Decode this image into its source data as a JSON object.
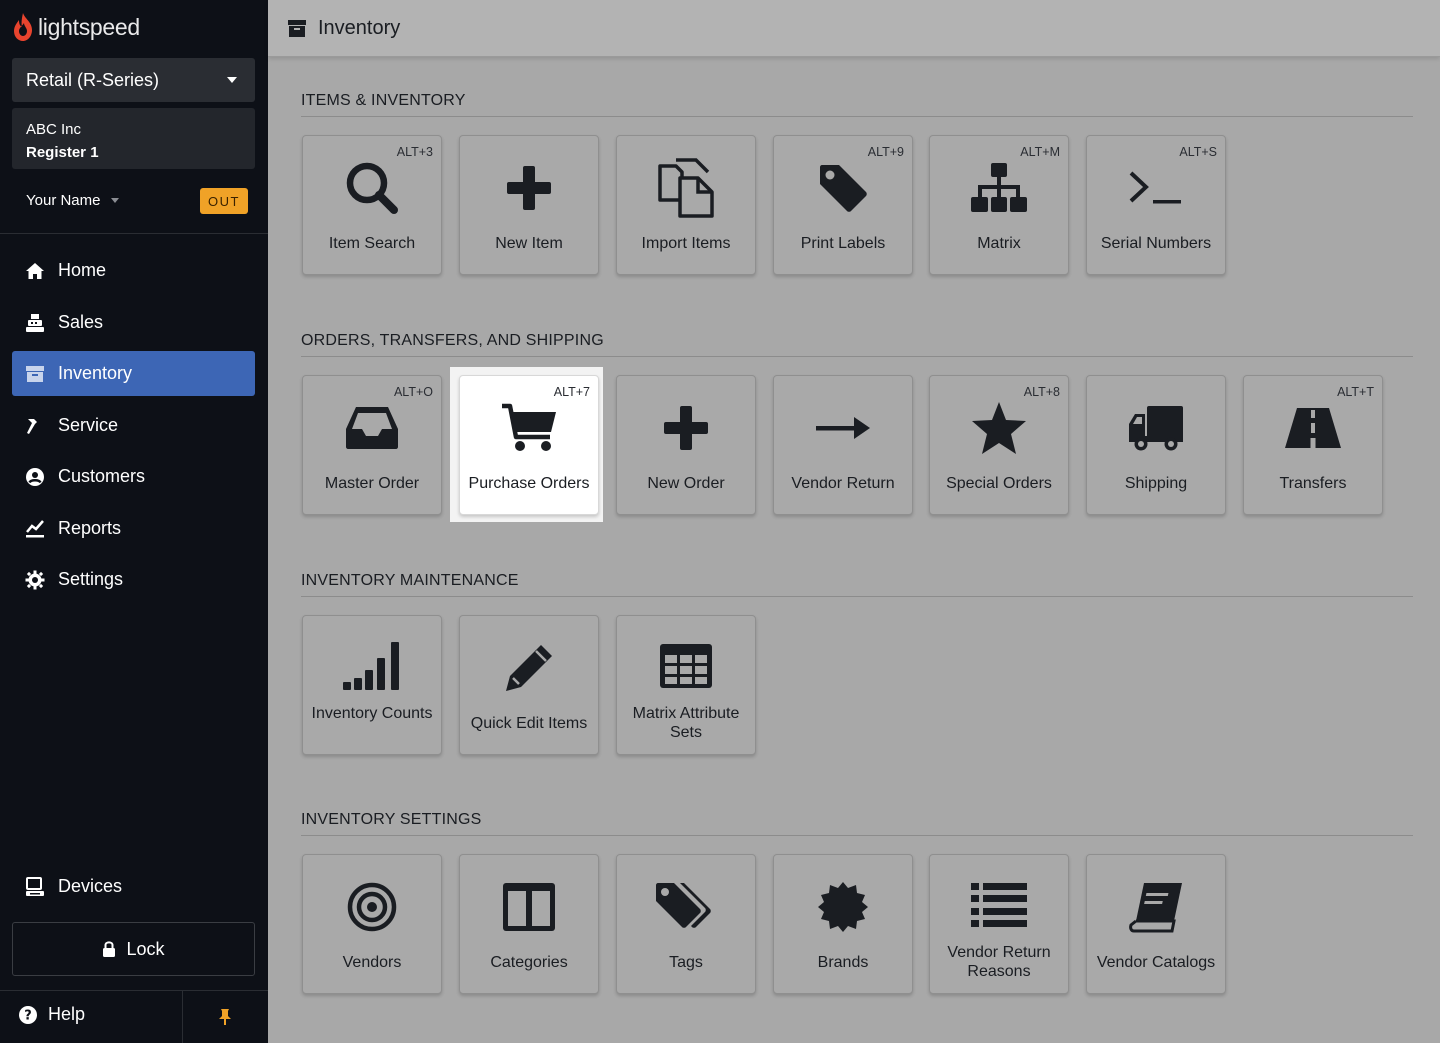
{
  "brand": {
    "name": "lightspeed",
    "accent": "#e8442e"
  },
  "sidebar": {
    "product": "Retail (R-Series)",
    "store": {
      "company": "ABC Inc",
      "register": "Register 1"
    },
    "user": {
      "name": "Your Name",
      "status_badge": "OUT"
    },
    "nav": [
      {
        "label": "Home",
        "icon": "home-icon"
      },
      {
        "label": "Sales",
        "icon": "register-icon"
      },
      {
        "label": "Inventory",
        "icon": "inventory-icon",
        "active": true
      },
      {
        "label": "Service",
        "icon": "wrench-icon"
      },
      {
        "label": "Customers",
        "icon": "user-circle-icon"
      },
      {
        "label": "Reports",
        "icon": "chart-icon"
      },
      {
        "label": "Settings",
        "icon": "gear-icon"
      }
    ],
    "devices": "Devices",
    "lock": "Lock",
    "help": "Help",
    "active_color": "#3d66b5"
  },
  "header": {
    "title": "Inventory"
  },
  "sections": [
    {
      "title": "ITEMS & INVENTORY",
      "tiles": [
        {
          "label": "Item Search",
          "shortcut": "ALT+3",
          "icon": "search-icon"
        },
        {
          "label": "New Item",
          "shortcut": "",
          "icon": "plus-icon"
        },
        {
          "label": "Import Items",
          "shortcut": "",
          "icon": "copy-icon"
        },
        {
          "label": "Print Labels",
          "shortcut": "ALT+9",
          "icon": "tag-icon"
        },
        {
          "label": "Matrix",
          "shortcut": "ALT+M",
          "icon": "sitemap-icon"
        },
        {
          "label": "Serial Numbers",
          "shortcut": "ALT+S",
          "icon": "terminal-icon"
        }
      ]
    },
    {
      "title": "ORDERS, TRANSFERS, AND SHIPPING",
      "tiles": [
        {
          "label": "Master Order",
          "shortcut": "ALT+O",
          "icon": "inbox-icon"
        },
        {
          "label": "Purchase Orders",
          "shortcut": "ALT+7",
          "icon": "cart-icon",
          "highlighted": true
        },
        {
          "label": "New Order",
          "shortcut": "",
          "icon": "plus-icon"
        },
        {
          "label": "Vendor Return",
          "shortcut": "",
          "icon": "arrow-right-icon"
        },
        {
          "label": "Special Orders",
          "shortcut": "ALT+8",
          "icon": "star-icon"
        },
        {
          "label": "Shipping",
          "shortcut": "",
          "icon": "truck-icon"
        },
        {
          "label": "Transfers",
          "shortcut": "ALT+T",
          "icon": "road-icon"
        }
      ]
    },
    {
      "title": "INVENTORY MAINTENANCE",
      "tiles": [
        {
          "label": "Inventory Counts",
          "shortcut": "",
          "icon": "signal-bars-icon"
        },
        {
          "label": "Quick Edit Items",
          "shortcut": "",
          "icon": "pencil-icon"
        },
        {
          "label": "Matrix Attribute Sets",
          "shortcut": "",
          "icon": "table-icon"
        }
      ]
    },
    {
      "title": "INVENTORY SETTINGS",
      "tiles": [
        {
          "label": "Vendors",
          "shortcut": "",
          "icon": "bullseye-icon"
        },
        {
          "label": "Categories",
          "shortcut": "",
          "icon": "columns-icon"
        },
        {
          "label": "Tags",
          "shortcut": "",
          "icon": "tags-icon"
        },
        {
          "label": "Brands",
          "shortcut": "",
          "icon": "certificate-icon"
        },
        {
          "label": "Vendor Return Reasons",
          "shortcut": "",
          "icon": "list-icon"
        },
        {
          "label": "Vendor Catalogs",
          "shortcut": "",
          "icon": "book-icon"
        }
      ]
    }
  ]
}
